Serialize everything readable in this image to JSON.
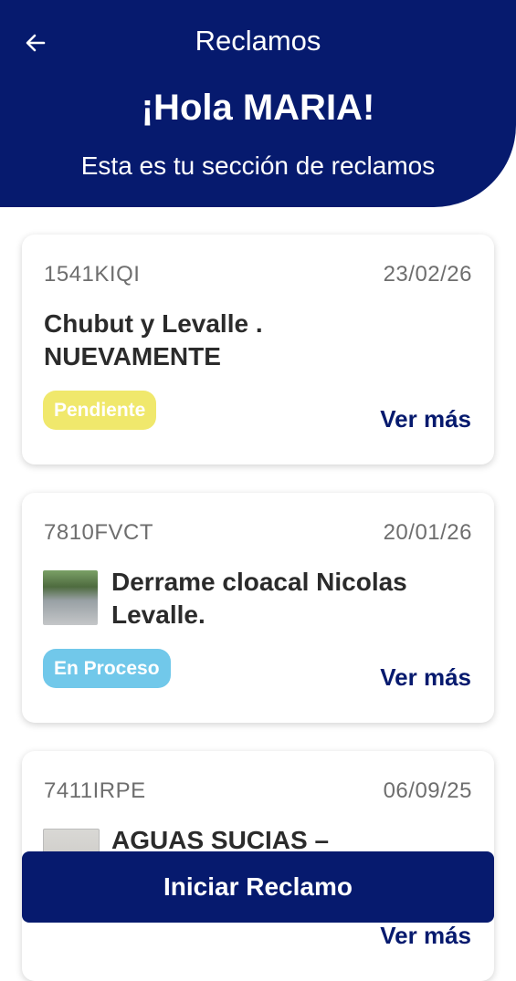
{
  "header": {
    "title": "Reclamos",
    "greeting": "¡Hola MARIA!",
    "subtitle": "Esta es tu sección de reclamos",
    "back_icon": "arrow-left-icon",
    "bg_color": "#061a6e"
  },
  "claims": [
    {
      "id": "1541KIQI",
      "date": "23/02/26",
      "title": "Chubut y Levalle . NUEVAMENTE",
      "status": "Pendiente",
      "status_color": "#f0e86c",
      "action": "Ver más"
    },
    {
      "id": "7810FVCT",
      "date": "20/01/26",
      "title": "Derrame cloacal Nicolas Levalle.",
      "status": "En Proceso",
      "status_color": "#71c8ea",
      "action": "Ver más"
    },
    {
      "id": "7411IRPE",
      "date": "06/09/25",
      "title": "AGUAS SUCIAS –",
      "action": "Ver más"
    }
  ],
  "footer": {
    "primary_button": "Iniciar Reclamo"
  }
}
